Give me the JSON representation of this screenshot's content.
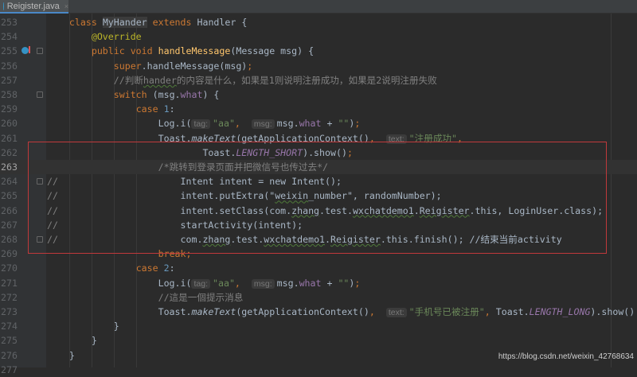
{
  "tab": {
    "title": "Reigister.java",
    "close": "×"
  },
  "watermark": "https://blog.csdn.net/weixin_42768634",
  "lines": [
    {
      "n": "253",
      "tokens": [
        [
          "    ",
          ""
        ],
        [
          "class ",
          "kw"
        ],
        [
          "MyHander",
          "hl"
        ],
        [
          " extends ",
          "kw"
        ],
        [
          "Handler {",
          ""
        ]
      ]
    },
    {
      "n": "254",
      "tokens": [
        [
          "        ",
          ""
        ],
        [
          "@Override",
          "ann"
        ]
      ]
    },
    {
      "n": "255",
      "marker": true,
      "fold": true,
      "tokens": [
        [
          "        ",
          ""
        ],
        [
          "public void ",
          "kw"
        ],
        [
          "handleMessage",
          "fn"
        ],
        [
          "(Message msg) {",
          ""
        ]
      ]
    },
    {
      "n": "256",
      "tokens": [
        [
          "            ",
          ""
        ],
        [
          "super",
          "kw"
        ],
        [
          ".handleMessage(msg)",
          ""
        ],
        [
          ";",
          "kw"
        ]
      ]
    },
    {
      "n": "257",
      "tokens": [
        [
          "            ",
          ""
        ],
        [
          "//判断",
          "cm"
        ],
        [
          "hander",
          "cm ul"
        ],
        [
          "的内容是什么，如果是1则说明注册成功，如果是2说明注册失败",
          "cm"
        ]
      ]
    },
    {
      "n": "258",
      "fold": true,
      "tokens": [
        [
          "            ",
          ""
        ],
        [
          "switch ",
          "kw"
        ],
        [
          "(msg.",
          ""
        ],
        [
          "what",
          "fld"
        ],
        [
          ") {",
          ""
        ]
      ]
    },
    {
      "n": "259",
      "tokens": [
        [
          "                ",
          ""
        ],
        [
          "case ",
          "kw"
        ],
        [
          "1",
          "num"
        ],
        [
          ":",
          ""
        ]
      ]
    },
    {
      "n": "260",
      "tokens": [
        [
          "                    Log.i(",
          ""
        ],
        [
          "tag:",
          "hint"
        ],
        [
          "\"aa\"",
          "str"
        ],
        [
          ",  ",
          "kw"
        ],
        [
          "msg:",
          "hint"
        ],
        [
          "msg.",
          ""
        ],
        [
          "what",
          "fld"
        ],
        [
          " + ",
          ""
        ],
        [
          "\"\"",
          "str"
        ],
        [
          ")",
          ""
        ],
        [
          ";",
          "kw"
        ]
      ]
    },
    {
      "n": "261",
      "tokens": [
        [
          "                    Toast.",
          ""
        ],
        [
          "makeText",
          "it"
        ],
        [
          "(getApplicationContext()",
          ""
        ],
        [
          ",  ",
          "kw"
        ],
        [
          "text:",
          "hint"
        ],
        [
          "\"注册成功\"",
          "str"
        ],
        [
          ",",
          "kw"
        ]
      ]
    },
    {
      "n": "262",
      "tokens": [
        [
          "                            Toast.",
          ""
        ],
        [
          "LENGTH_SHORT",
          "cst"
        ],
        [
          ").show()",
          ""
        ],
        [
          ";",
          "kw"
        ]
      ]
    },
    {
      "n": "263",
      "cur": true,
      "tokens": [
        [
          "                    ",
          ""
        ],
        [
          "/*跳转到登录页面并把微信号也传过去*/",
          "cm"
        ]
      ]
    },
    {
      "n": "264",
      "fold": true,
      "tokens": [
        [
          "//",
          "cm"
        ],
        [
          "                      Intent intent = new Intent();",
          ""
        ]
      ]
    },
    {
      "n": "265",
      "tokens": [
        [
          "//",
          "cm"
        ],
        [
          "                      intent.putExtra(\"",
          ""
        ],
        [
          "weixin",
          "ul"
        ],
        [
          "_number\", randomNumber);",
          ""
        ]
      ]
    },
    {
      "n": "266",
      "tokens": [
        [
          "//",
          "cm"
        ],
        [
          "                      intent.setClass(com.",
          ""
        ],
        [
          "zhang",
          "ul"
        ],
        [
          ".test.",
          ""
        ],
        [
          "wxchatdemo1",
          "ul"
        ],
        [
          ".",
          ""
        ],
        [
          "Reigister",
          "ul"
        ],
        [
          ".this, LoginUser.class);",
          ""
        ]
      ]
    },
    {
      "n": "267",
      "tokens": [
        [
          "//",
          "cm"
        ],
        [
          "                      startActivity(intent);",
          ""
        ]
      ]
    },
    {
      "n": "268",
      "fold": true,
      "tokens": [
        [
          "//",
          "cm"
        ],
        [
          "                      com.",
          ""
        ],
        [
          "zhang",
          "ul"
        ],
        [
          ".test.",
          ""
        ],
        [
          "wxchatdemo1",
          "ul"
        ],
        [
          ".",
          ""
        ],
        [
          "Reigister",
          "ul"
        ],
        [
          ".this.finish(); //结束当前activity",
          ""
        ]
      ]
    },
    {
      "n": "269",
      "tokens": [
        [
          "                    ",
          ""
        ],
        [
          "break;",
          "kw"
        ]
      ]
    },
    {
      "n": "270",
      "tokens": [
        [
          "                ",
          ""
        ],
        [
          "case ",
          "kw"
        ],
        [
          "2",
          "num"
        ],
        [
          ":",
          ""
        ]
      ]
    },
    {
      "n": "271",
      "tokens": [
        [
          "                    Log.i(",
          ""
        ],
        [
          "tag:",
          "hint"
        ],
        [
          "\"aa\"",
          "str"
        ],
        [
          ",  ",
          "kw"
        ],
        [
          "msg:",
          "hint"
        ],
        [
          "msg.",
          ""
        ],
        [
          "what",
          "fld"
        ],
        [
          " + ",
          ""
        ],
        [
          "\"\"",
          "str"
        ],
        [
          ")",
          ""
        ],
        [
          ";",
          "kw"
        ]
      ]
    },
    {
      "n": "272",
      "tokens": [
        [
          "                    ",
          ""
        ],
        [
          "//這是一個提示消息",
          "cm"
        ]
      ]
    },
    {
      "n": "273",
      "tokens": [
        [
          "                    Toast.",
          ""
        ],
        [
          "makeText",
          "it"
        ],
        [
          "(getApplicationContext()",
          ""
        ],
        [
          ",  ",
          "kw"
        ],
        [
          "text:",
          "hint"
        ],
        [
          "\"手机号已被注册\"",
          "str"
        ],
        [
          ", ",
          "kw"
        ],
        [
          "Toast.",
          ""
        ],
        [
          "LENGTH_LONG",
          "cst"
        ],
        [
          ").show()",
          ""
        ]
      ]
    },
    {
      "n": "274",
      "tokens": [
        [
          "            }",
          ""
        ]
      ]
    },
    {
      "n": "275",
      "tokens": [
        [
          "        }",
          ""
        ]
      ]
    },
    {
      "n": "276",
      "tokens": [
        [
          "    }",
          ""
        ]
      ]
    },
    {
      "n": "277",
      "tokens": []
    }
  ]
}
